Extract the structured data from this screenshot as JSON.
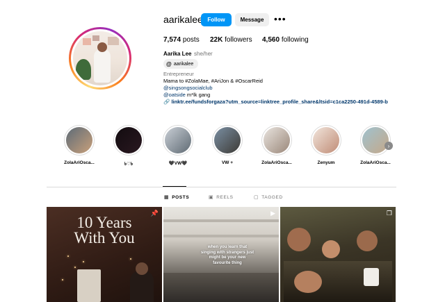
{
  "profile": {
    "username": "aarikalee",
    "follow_label": "Follow",
    "message_label": "Message",
    "more_label": "•••",
    "stats": {
      "posts_count": "7,574",
      "posts_label": "posts",
      "followers_count": "22K",
      "followers_label": "followers",
      "following_count": "4,560",
      "following_label": "following"
    },
    "full_name": "Aarika Lee",
    "pronouns": "she/her",
    "threads_glyph": "@",
    "threads_handle": "aarikalee",
    "category": "Entrepreneur",
    "bio": "Mama to #ZolaMae, #AriJon & #OscarReid",
    "bio_link": "@singsongsocialclub",
    "bio_mention_handle": "@oatside",
    "bio_mention_rest": " m*lk gang",
    "external_link_icon": "🔗",
    "external_link": "linktr.ee/fundsforgaza?utm_source=linktree_profile_share&ltsid=c1ca2250-491d-4589-b"
  },
  "highlights": [
    {
      "label": "ZolaAriOsca...",
      "color_a": "#5d6b78",
      "color_b": "#c9a07a"
    },
    {
      "label": "৳♡৳",
      "color_a": "#120c10",
      "color_b": "#2a1820"
    },
    {
      "label": "🖤VW🖤",
      "color_a": "#c9cfd6",
      "color_b": "#5f6a73"
    },
    {
      "label": "VW +",
      "color_a": "#7a8fa3",
      "color_b": "#3d3a35"
    },
    {
      "label": "ZolaAriOsca...",
      "color_a": "#e9e4df",
      "color_b": "#9a8779"
    },
    {
      "label": "Zenyum",
      "color_a": "#f1e5dc",
      "color_b": "#c08c76"
    },
    {
      "label": "ZolaAriOsca...",
      "color_a": "#9fc2cf",
      "color_b": "#c5a889"
    }
  ],
  "highlights_next_icon": "›",
  "tabs": [
    {
      "label": "POSTS",
      "icon": "▦",
      "active": true
    },
    {
      "label": "REELS",
      "icon": "▣",
      "active": false
    },
    {
      "label": "TAGGED",
      "icon": "▢",
      "active": false
    }
  ],
  "posts": {
    "p1_title_line1": "10 Years",
    "p1_title_line2": "With You",
    "p1_icon": "📌",
    "p2_caption": "when you learn that singing with strangers just might be your new favourite thing",
    "p2_icon": "▶",
    "p3_icon": "❐"
  }
}
